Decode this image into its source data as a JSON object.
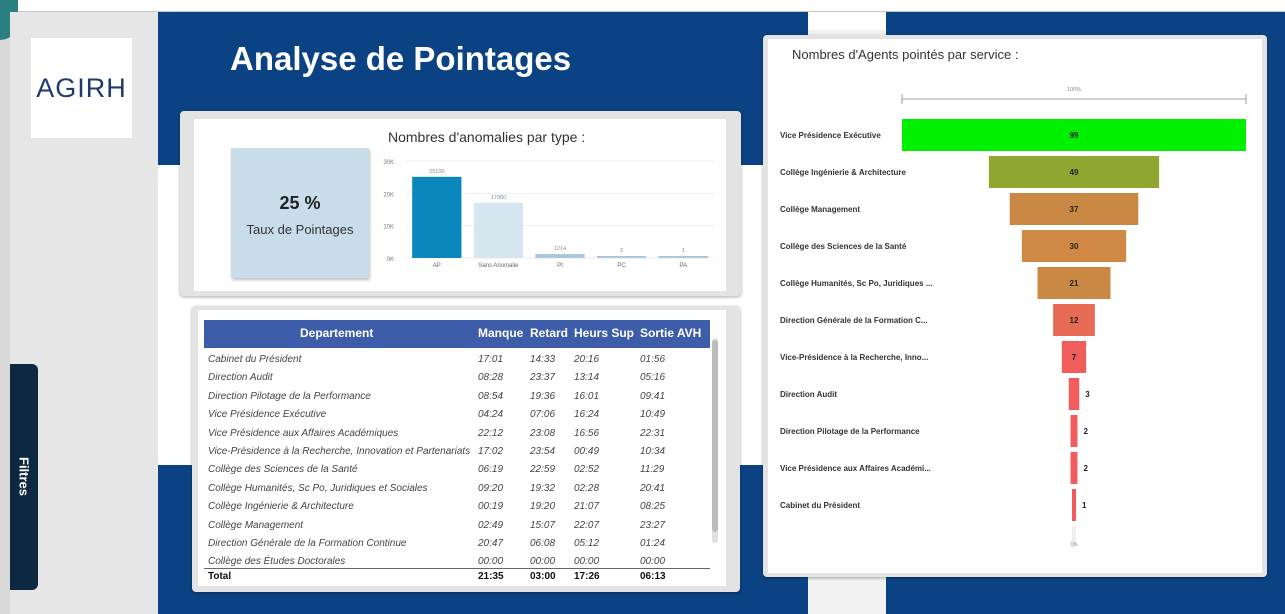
{
  "logo": {
    "text": "AGIRH"
  },
  "filters": {
    "label": "Filtres"
  },
  "dashboard": {
    "title": "Analyse de Pointages"
  },
  "kpi": {
    "value": "25 %",
    "label": "Taux de Pointages"
  },
  "colors": {
    "header_blue": "#0b4283",
    "table_header": "#3d5daa",
    "bar_dark": "#0a87bd",
    "bar_light": "#d6e6ef",
    "kpi_bg": "#c8dcea"
  },
  "chart_data": [
    {
      "type": "bar",
      "title": "Nombres d'anomalies par type :",
      "categories": [
        "AP",
        "Sans Anomalie",
        "PI",
        "PC",
        "PA"
      ],
      "values": [
        25100,
        17060,
        1214,
        2,
        1
      ],
      "data_labels": [
        "25100",
        "17060",
        "1214",
        "2",
        "1"
      ],
      "yticks": [
        "0K",
        "10K",
        "20K",
        "30K"
      ],
      "ylim": [
        0,
        30000
      ],
      "colors": [
        "#0a87bd",
        "#d6e6ef",
        "#a9c6da",
        "#a9c6da",
        "#a9c6da"
      ],
      "grid": true
    },
    {
      "type": "bar",
      "subtype": "funnel",
      "title": "Nombres d'Agents pointés par service :",
      "top_label": "100%",
      "bottom_label": "1%",
      "categories": [
        "Vice Présidence Exécutive",
        "Collège Ingénierie & Architecture",
        "Collège Management",
        "Collège des Sciences de la Santé",
        "Collège Humanités, Sc Po, Juridiques ...",
        "Direction Générale de la Formation C...",
        "Vice-Présidence à la Recherche, Inno...",
        "Direction Audit",
        "Direction Pilotage de la Performance",
        "Vice Présidence aux Affaires Académi...",
        "Cabinet du Président"
      ],
      "values": [
        99,
        49,
        37,
        30,
        21,
        12,
        7,
        3,
        2,
        2,
        1
      ],
      "colors": [
        "#00f000",
        "#8fa631",
        "#c98944",
        "#cf8944",
        "#c98944",
        "#e76b54",
        "#ef5e5b",
        "#f25c5c",
        "#f25c5c",
        "#f25c5c",
        "#f25c5c"
      ]
    }
  ],
  "table": {
    "columns": [
      "Departement",
      "Manque",
      "Retard",
      "Heurs Sup",
      "Sortie AVH"
    ],
    "rows": [
      [
        "Cabinet du Président",
        "17:01",
        "14:33",
        "20:16",
        "01:56"
      ],
      [
        "Direction Audit",
        "08:28",
        "23:37",
        "13:14",
        "05:16"
      ],
      [
        "Direction Pilotage de la Performance",
        "08:54",
        "19:36",
        "16:01",
        "09:41"
      ],
      [
        "Vice Présidence Exécutive",
        "04:24",
        "07:06",
        "16:24",
        "10:49"
      ],
      [
        "Vice Présidence aux Affaires Académiques",
        "22:12",
        "23:08",
        "16:56",
        "22:31"
      ],
      [
        "Vice-Présidence à la Recherche, Innovation et Partenariats",
        "17:02",
        "23:54",
        "00:49",
        "10:34"
      ],
      [
        "Collège des Sciences de la Santé",
        "06:19",
        "22:59",
        "02:52",
        "11:29"
      ],
      [
        "Collège Humanités, Sc Po, Juridiques et Sociales",
        "09:20",
        "19:32",
        "02:28",
        "20:41"
      ],
      [
        "Collège Ingénierie & Architecture",
        "00:19",
        "19:20",
        "21:07",
        "08:25"
      ],
      [
        "Collège Management",
        "02:49",
        "15:07",
        "22:07",
        "23:27"
      ],
      [
        "Direction Générale de la Formation Continue",
        "20:47",
        "06:08",
        "05:12",
        "01:24"
      ],
      [
        "Collège des Études Doctorales",
        "00:00",
        "00:00",
        "00:00",
        "00:00"
      ]
    ],
    "total": [
      "Total",
      "21:35",
      "03:00",
      "17:26",
      "06:13"
    ]
  }
}
